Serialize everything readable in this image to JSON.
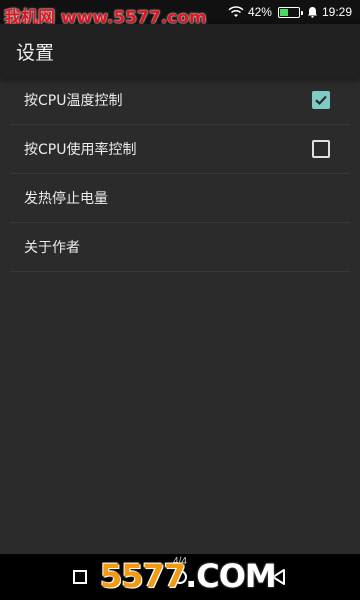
{
  "status_bar": {
    "watermark": "我机网 www.5577.com",
    "battery_percent": "42%",
    "battery_level": 0.42,
    "time": "19:29"
  },
  "header": {
    "title": "设置"
  },
  "settings": [
    {
      "label": "按CPU温度控制",
      "checkbox": "checked"
    },
    {
      "label": "按CPU使用率控制",
      "checkbox": "unchecked"
    },
    {
      "label": "发热停止电量"
    },
    {
      "label": "关于作者"
    }
  ],
  "nav_bar": {
    "page_indicator": "4/4",
    "watermark_number": "5577",
    "watermark_dot": ".",
    "watermark_suffix": "COM"
  },
  "colors": {
    "background": "#2b2b2b",
    "app_bar": "#212121",
    "checkbox_accent": "#80cbc4",
    "watermark_red": "#e0141e",
    "watermark_orange": "#f29a12"
  }
}
